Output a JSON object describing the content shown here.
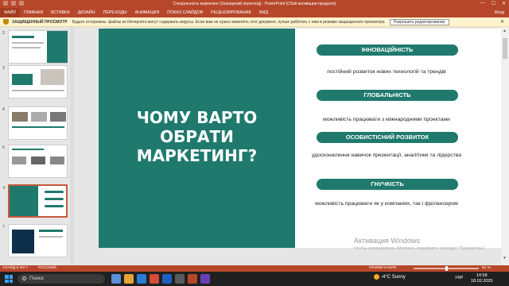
{
  "window": {
    "title": "Спеціальність маркетинг [Захищений перегляд] - PowerPoint (Сбой активации продукта)",
    "controls": [
      "—",
      "☐",
      "✕"
    ]
  },
  "ribbon": {
    "tabs": [
      "ФАЙЛ",
      "ГЛАВНАЯ",
      "ВСТАВКА",
      "ДИЗАЙН",
      "ПЕРЕХОДЫ",
      "АНИМАЦИЯ",
      "ПОКАЗ СЛАЙДОВ",
      "РЕЦЕНЗИРОВАНИЕ",
      "ВИД"
    ],
    "signin": "Вход"
  },
  "protected_view": {
    "label": "ЗАЩИЩЕННЫЙ ПРОСМОТР",
    "message": "Будьте осторожны: файлы из Интернета могут содержать вирусы. Если вам не нужно изменять этот документ, лучше работать с ним в режиме защищенного просмотра.",
    "enable_button": "Разрешить редактирование"
  },
  "thumbnails": {
    "numbers": [
      "2",
      "3",
      "4",
      "5",
      "6",
      "7"
    ],
    "selected_index": 4
  },
  "slide": {
    "heading": [
      "ЧОМУ ВАРТО",
      "ОБРАТИ",
      "МАРКЕТИНГ?"
    ],
    "items": [
      {
        "title": "ІННОВАЦІЙНІСТЬ",
        "text": "постійний розвиток нових технологій та трендів"
      },
      {
        "title": "ГЛОБАЛЬНІСТЬ",
        "text": "можливість працювати з міжнародними проектами"
      },
      {
        "title": "ОСОБИСТІСНИЙ РОЗВИТОК",
        "text": "удосконалення навичок презентації, аналітики та лідерства"
      },
      {
        "title": "ГНУЧКІСТЬ",
        "text": "можливість працювати як у компаніях, так і фрілансером"
      }
    ],
    "colors": {
      "teal": "#1f7a6d",
      "white": "#ffffff"
    }
  },
  "watermark": {
    "title": "Активация Windows",
    "text": "Чтобы активировать Windows, перейдите в раздел \"Параметры\"."
  },
  "statusbar": {
    "slide_info": "СЛАЙД 6 ИЗ 7",
    "language": "РУССКИЙ",
    "notes": "ПРИМЕЧАНИЯ",
    "zoom": "61 %"
  },
  "taskbar": {
    "search_placeholder": "Поиск",
    "weather": "-4°C  Sunny",
    "lang": "УКР",
    "time": "14:58",
    "date": "18.02.2025"
  }
}
